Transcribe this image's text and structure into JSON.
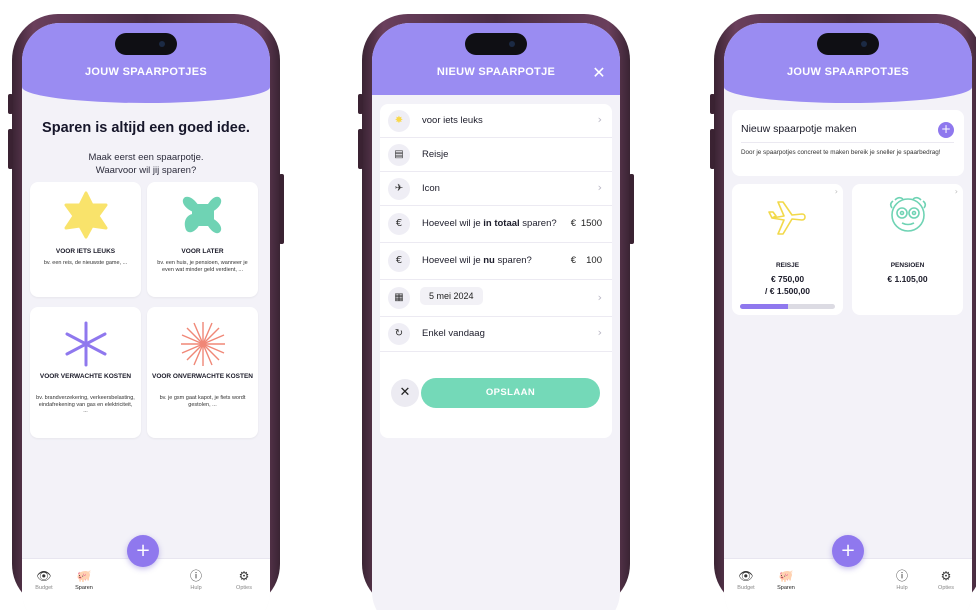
{
  "screen1": {
    "header_title": "JOUW SPAARPOTJES",
    "title": "Sparen is altijd een goed idee.",
    "subtitle_line1": "Maak eerst een spaarpotje.",
    "subtitle_line2": "Waarvoor wil jij sparen?",
    "categories": [
      {
        "label": "VOOR IETS LEUKS",
        "desc": "bv. een reis, de nieuwste game, ...",
        "color": "#f9e36b"
      },
      {
        "label": "VOOR LATER",
        "desc": "bv. een huis, je pensioen, wanneer je even wat minder geld verdient, ...",
        "color": "#6fd3b4"
      },
      {
        "label": "VOOR VERWACHTE KOSTEN",
        "desc": "bv. brandverzekering, verkeersbelasting, eindafrekening van gas en elektriciteit, ...",
        "color": "#8f78ee"
      },
      {
        "label": "VOOR ONVERWACHTE KOSTEN",
        "desc": "bv. je gsm gaat kapot, je fiets wordt gestolen, ...",
        "color": "#f08777"
      }
    ]
  },
  "screen2": {
    "header_title": "NIEUW SPAARPOTJE",
    "close": "✕",
    "category": "voor iets leuks",
    "name": "Reisje",
    "icon_label": "Icon",
    "total_q_pre": "Hoeveel wil je ",
    "total_q_bold": "in totaal",
    "total_q_post": " sparen?",
    "total_currency": "€",
    "total_value": "1500",
    "now_q_pre": "Hoeveel wil je ",
    "now_q_bold": "nu",
    "now_q_post": " sparen?",
    "now_currency": "€",
    "now_value": "100",
    "date": "5 mei 2024",
    "repeat": "Enkel vandaag",
    "save": "OPSLAAN"
  },
  "screen3": {
    "header_title": "JOUW SPAARPOTJES",
    "new_title": "Nieuw spaarpotje maken",
    "new_desc": "Door je spaarpotjes concreet te maken bereik je sneller je spaarbedrag!",
    "pots": [
      {
        "name": "REISJE",
        "amount": "€ 750,00",
        "target": "/ € 1.500,00",
        "progress": 0.5,
        "icon": "airplane-icon"
      },
      {
        "name": "PENSIOEN",
        "amount": "€ 1.105,00",
        "icon": "old-face-icon"
      }
    ]
  },
  "tabs": [
    "Budget",
    "Sparen",
    "Hulp",
    "Opties"
  ],
  "colors": {
    "purple": "#9a8cf2",
    "accent": "#8f78ee",
    "mint": "#74d9b8",
    "yellow": "#f9e36b",
    "coral": "#f08777"
  }
}
